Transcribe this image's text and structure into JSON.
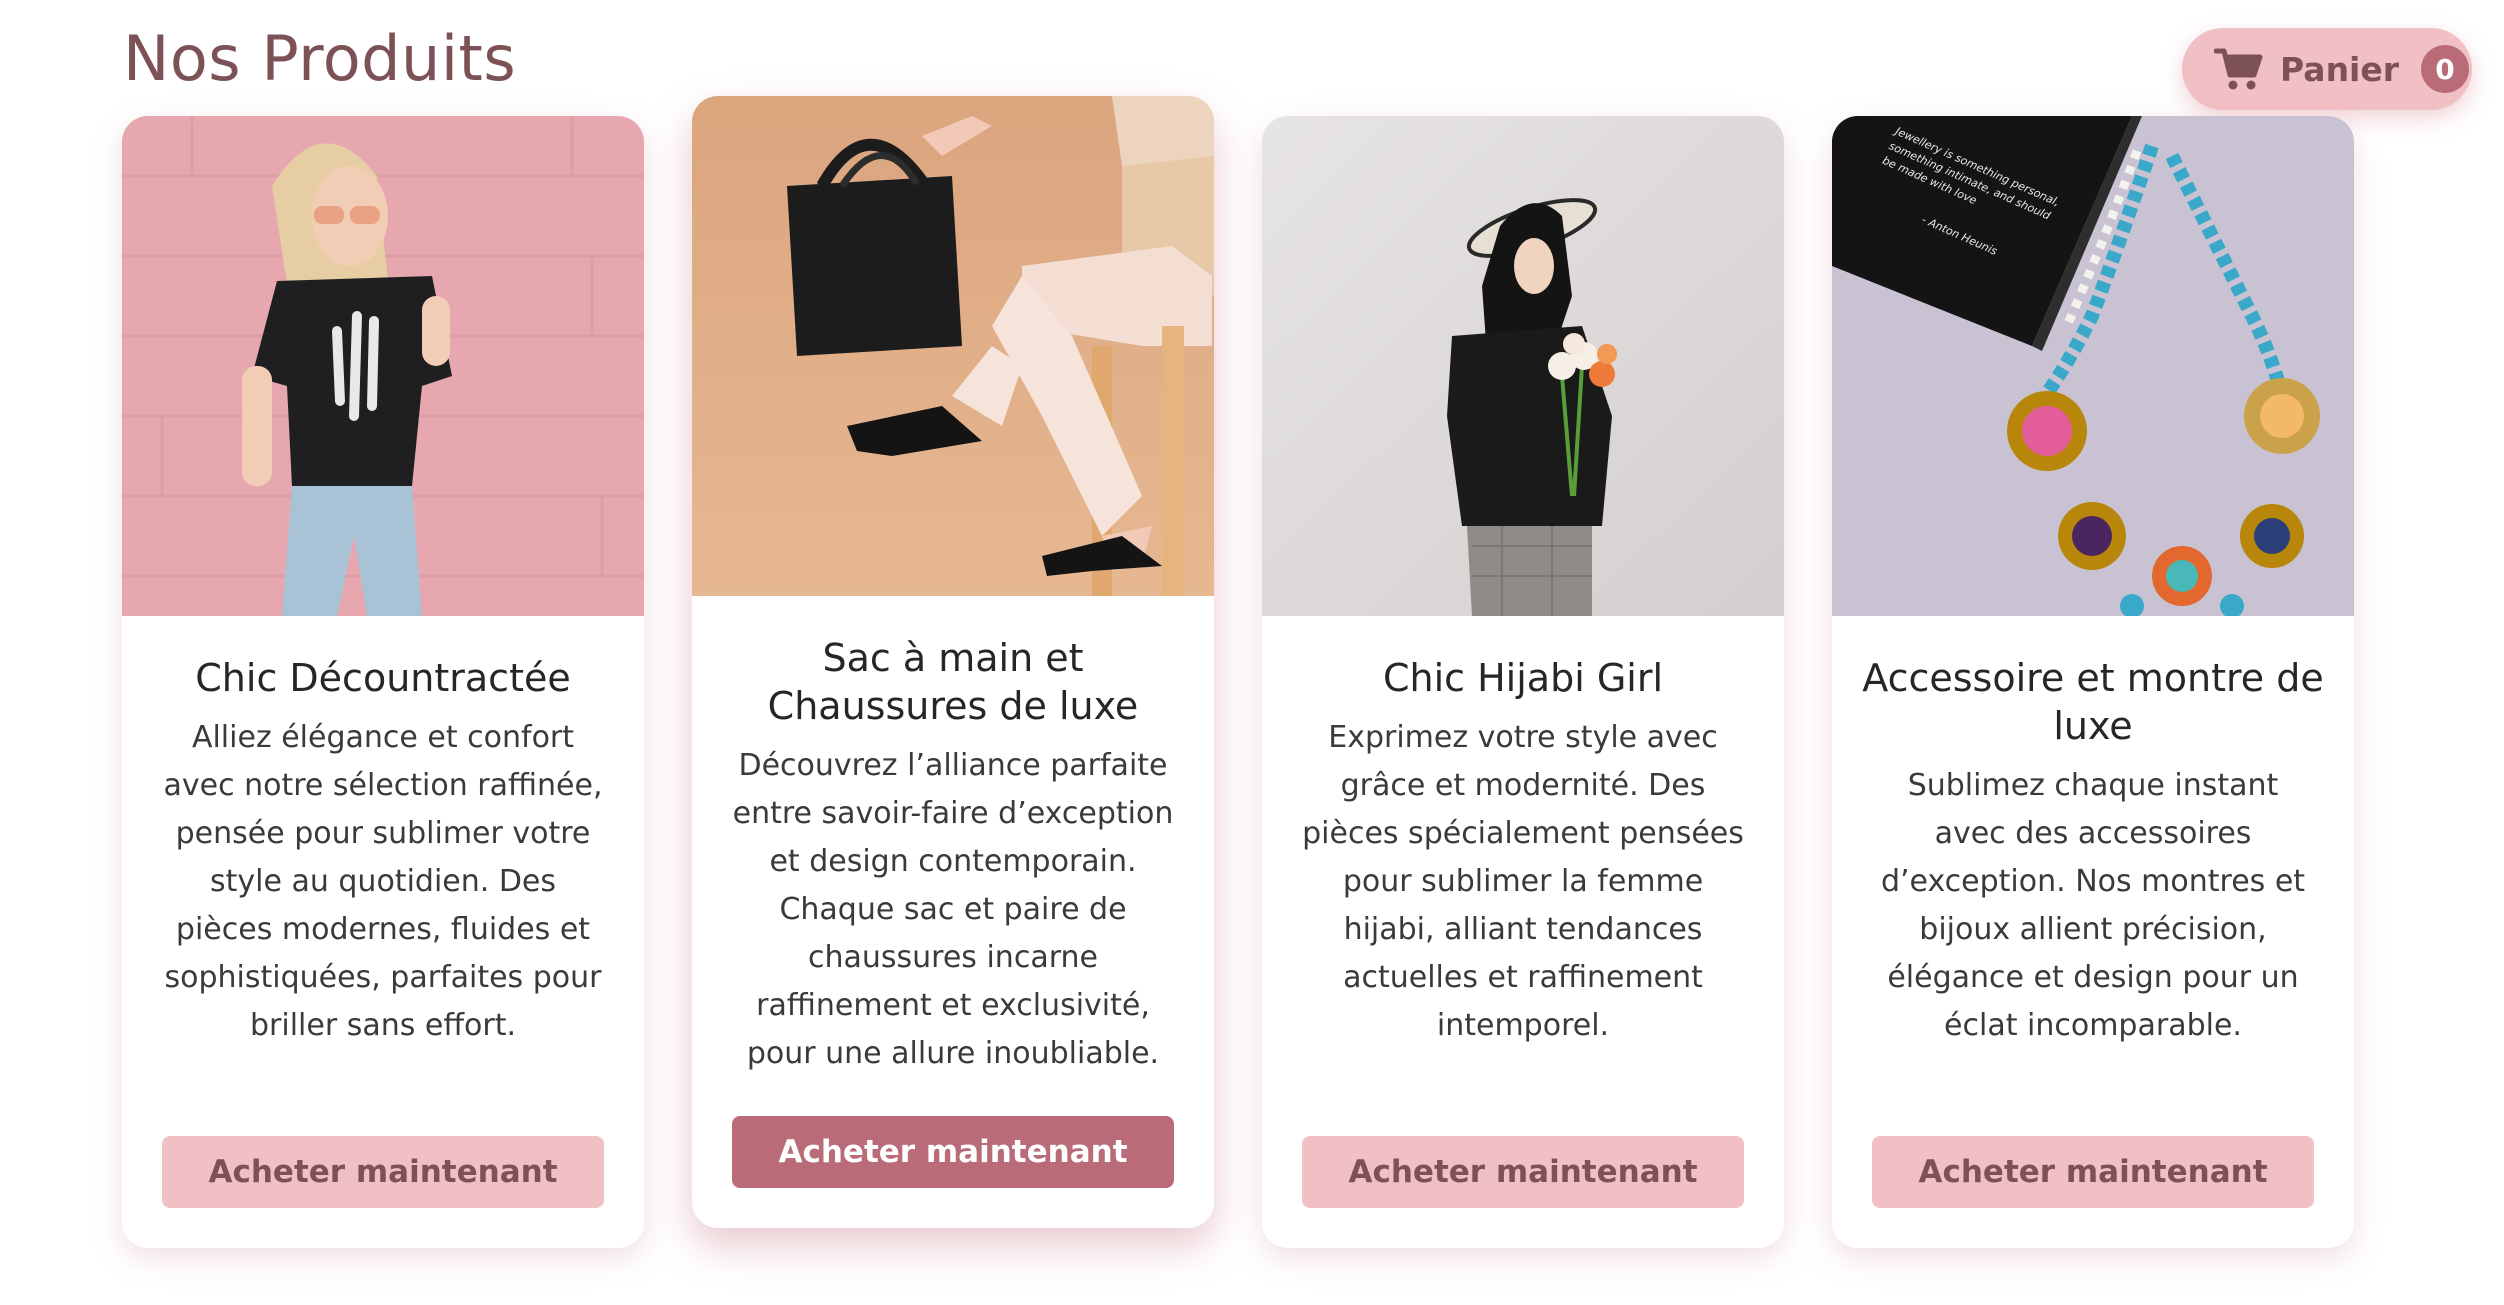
{
  "header": {
    "title": "Nos Produits",
    "cart_label": "Panier",
    "cart_count": "0",
    "cart_icon": "shopping-cart-icon"
  },
  "colors": {
    "title": "#7d5257",
    "button_light": "#f1c0c4",
    "button_dark": "#b96b78"
  },
  "products": [
    {
      "title": "Chic Décountractée",
      "description": "Alliez élégance et confort avec notre sélection raffinée, pensée pour sublimer votre style au quotidien. Des pièces modernes, fluides et sophistiquées, parfaites pour briller sans effort.",
      "button": "Acheter maintenant"
    },
    {
      "title": "Sac à main et Chaussures de luxe",
      "description": "Découvrez l’alliance parfaite entre savoir-faire d’exception et design contemporain. Chaque sac et paire de chaussures incarne raffinement et exclusivité, pour une allure inoubliable.",
      "button": "Acheter maintenant"
    },
    {
      "title": "Chic Hijabi Girl",
      "description": "Exprimez votre style avec grâce et modernité. Des pièces spécialement pensées pour sublimer la femme hijabi, alliant tendances actuelles et raffinement intemporel.",
      "button": "Acheter maintenant"
    },
    {
      "title": "Accessoire et montre de luxe",
      "description": "Sublimez chaque instant avec des accessoires d’exception. Nos montres et bijoux allient précision, élégance et design pour un éclat incomparable.",
      "button": "Acheter maintenant",
      "image_caption": "Jewellery is something personal, something intimate, and should be made with love — Anton Heunis"
    }
  ]
}
